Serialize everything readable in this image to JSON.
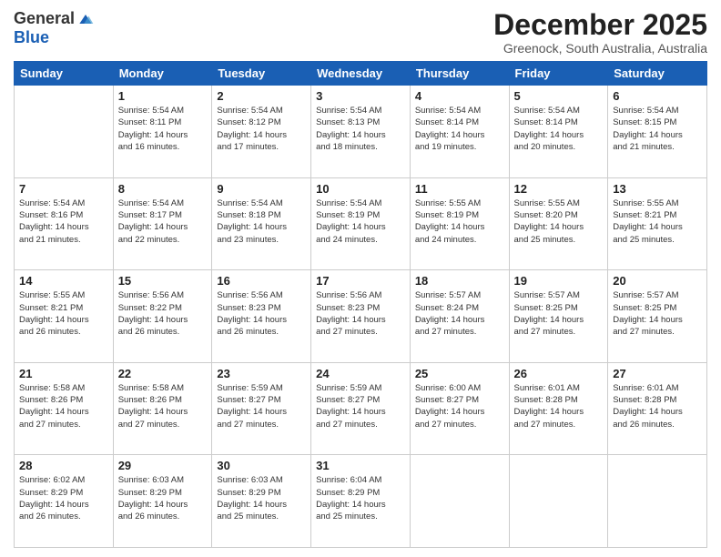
{
  "logo": {
    "general": "General",
    "blue": "Blue"
  },
  "title": "December 2025",
  "subtitle": "Greenock, South Australia, Australia",
  "days": [
    "Sunday",
    "Monday",
    "Tuesday",
    "Wednesday",
    "Thursday",
    "Friday",
    "Saturday"
  ],
  "weeks": [
    [
      {
        "day": "",
        "sunrise": "",
        "sunset": "",
        "daylight": ""
      },
      {
        "day": "1",
        "sunrise": "Sunrise: 5:54 AM",
        "sunset": "Sunset: 8:11 PM",
        "daylight": "Daylight: 14 hours and 16 minutes."
      },
      {
        "day": "2",
        "sunrise": "Sunrise: 5:54 AM",
        "sunset": "Sunset: 8:12 PM",
        "daylight": "Daylight: 14 hours and 17 minutes."
      },
      {
        "day": "3",
        "sunrise": "Sunrise: 5:54 AM",
        "sunset": "Sunset: 8:13 PM",
        "daylight": "Daylight: 14 hours and 18 minutes."
      },
      {
        "day": "4",
        "sunrise": "Sunrise: 5:54 AM",
        "sunset": "Sunset: 8:14 PM",
        "daylight": "Daylight: 14 hours and 19 minutes."
      },
      {
        "day": "5",
        "sunrise": "Sunrise: 5:54 AM",
        "sunset": "Sunset: 8:14 PM",
        "daylight": "Daylight: 14 hours and 20 minutes."
      },
      {
        "day": "6",
        "sunrise": "Sunrise: 5:54 AM",
        "sunset": "Sunset: 8:15 PM",
        "daylight": "Daylight: 14 hours and 21 minutes."
      }
    ],
    [
      {
        "day": "7",
        "sunrise": "Sunrise: 5:54 AM",
        "sunset": "Sunset: 8:16 PM",
        "daylight": "Daylight: 14 hours and 21 minutes."
      },
      {
        "day": "8",
        "sunrise": "Sunrise: 5:54 AM",
        "sunset": "Sunset: 8:17 PM",
        "daylight": "Daylight: 14 hours and 22 minutes."
      },
      {
        "day": "9",
        "sunrise": "Sunrise: 5:54 AM",
        "sunset": "Sunset: 8:18 PM",
        "daylight": "Daylight: 14 hours and 23 minutes."
      },
      {
        "day": "10",
        "sunrise": "Sunrise: 5:54 AM",
        "sunset": "Sunset: 8:19 PM",
        "daylight": "Daylight: 14 hours and 24 minutes."
      },
      {
        "day": "11",
        "sunrise": "Sunrise: 5:55 AM",
        "sunset": "Sunset: 8:19 PM",
        "daylight": "Daylight: 14 hours and 24 minutes."
      },
      {
        "day": "12",
        "sunrise": "Sunrise: 5:55 AM",
        "sunset": "Sunset: 8:20 PM",
        "daylight": "Daylight: 14 hours and 25 minutes."
      },
      {
        "day": "13",
        "sunrise": "Sunrise: 5:55 AM",
        "sunset": "Sunset: 8:21 PM",
        "daylight": "Daylight: 14 hours and 25 minutes."
      }
    ],
    [
      {
        "day": "14",
        "sunrise": "Sunrise: 5:55 AM",
        "sunset": "Sunset: 8:21 PM",
        "daylight": "Daylight: 14 hours and 26 minutes."
      },
      {
        "day": "15",
        "sunrise": "Sunrise: 5:56 AM",
        "sunset": "Sunset: 8:22 PM",
        "daylight": "Daylight: 14 hours and 26 minutes."
      },
      {
        "day": "16",
        "sunrise": "Sunrise: 5:56 AM",
        "sunset": "Sunset: 8:23 PM",
        "daylight": "Daylight: 14 hours and 26 minutes."
      },
      {
        "day": "17",
        "sunrise": "Sunrise: 5:56 AM",
        "sunset": "Sunset: 8:23 PM",
        "daylight": "Daylight: 14 hours and 27 minutes."
      },
      {
        "day": "18",
        "sunrise": "Sunrise: 5:57 AM",
        "sunset": "Sunset: 8:24 PM",
        "daylight": "Daylight: 14 hours and 27 minutes."
      },
      {
        "day": "19",
        "sunrise": "Sunrise: 5:57 AM",
        "sunset": "Sunset: 8:25 PM",
        "daylight": "Daylight: 14 hours and 27 minutes."
      },
      {
        "day": "20",
        "sunrise": "Sunrise: 5:57 AM",
        "sunset": "Sunset: 8:25 PM",
        "daylight": "Daylight: 14 hours and 27 minutes."
      }
    ],
    [
      {
        "day": "21",
        "sunrise": "Sunrise: 5:58 AM",
        "sunset": "Sunset: 8:26 PM",
        "daylight": "Daylight: 14 hours and 27 minutes."
      },
      {
        "day": "22",
        "sunrise": "Sunrise: 5:58 AM",
        "sunset": "Sunset: 8:26 PM",
        "daylight": "Daylight: 14 hours and 27 minutes."
      },
      {
        "day": "23",
        "sunrise": "Sunrise: 5:59 AM",
        "sunset": "Sunset: 8:27 PM",
        "daylight": "Daylight: 14 hours and 27 minutes."
      },
      {
        "day": "24",
        "sunrise": "Sunrise: 5:59 AM",
        "sunset": "Sunset: 8:27 PM",
        "daylight": "Daylight: 14 hours and 27 minutes."
      },
      {
        "day": "25",
        "sunrise": "Sunrise: 6:00 AM",
        "sunset": "Sunset: 8:27 PM",
        "daylight": "Daylight: 14 hours and 27 minutes."
      },
      {
        "day": "26",
        "sunrise": "Sunrise: 6:01 AM",
        "sunset": "Sunset: 8:28 PM",
        "daylight": "Daylight: 14 hours and 27 minutes."
      },
      {
        "day": "27",
        "sunrise": "Sunrise: 6:01 AM",
        "sunset": "Sunset: 8:28 PM",
        "daylight": "Daylight: 14 hours and 26 minutes."
      }
    ],
    [
      {
        "day": "28",
        "sunrise": "Sunrise: 6:02 AM",
        "sunset": "Sunset: 8:29 PM",
        "daylight": "Daylight: 14 hours and 26 minutes."
      },
      {
        "day": "29",
        "sunrise": "Sunrise: 6:03 AM",
        "sunset": "Sunset: 8:29 PM",
        "daylight": "Daylight: 14 hours and 26 minutes."
      },
      {
        "day": "30",
        "sunrise": "Sunrise: 6:03 AM",
        "sunset": "Sunset: 8:29 PM",
        "daylight": "Daylight: 14 hours and 25 minutes."
      },
      {
        "day": "31",
        "sunrise": "Sunrise: 6:04 AM",
        "sunset": "Sunset: 8:29 PM",
        "daylight": "Daylight: 14 hours and 25 minutes."
      },
      {
        "day": "",
        "sunrise": "",
        "sunset": "",
        "daylight": ""
      },
      {
        "day": "",
        "sunrise": "",
        "sunset": "",
        "daylight": ""
      },
      {
        "day": "",
        "sunrise": "",
        "sunset": "",
        "daylight": ""
      }
    ]
  ]
}
